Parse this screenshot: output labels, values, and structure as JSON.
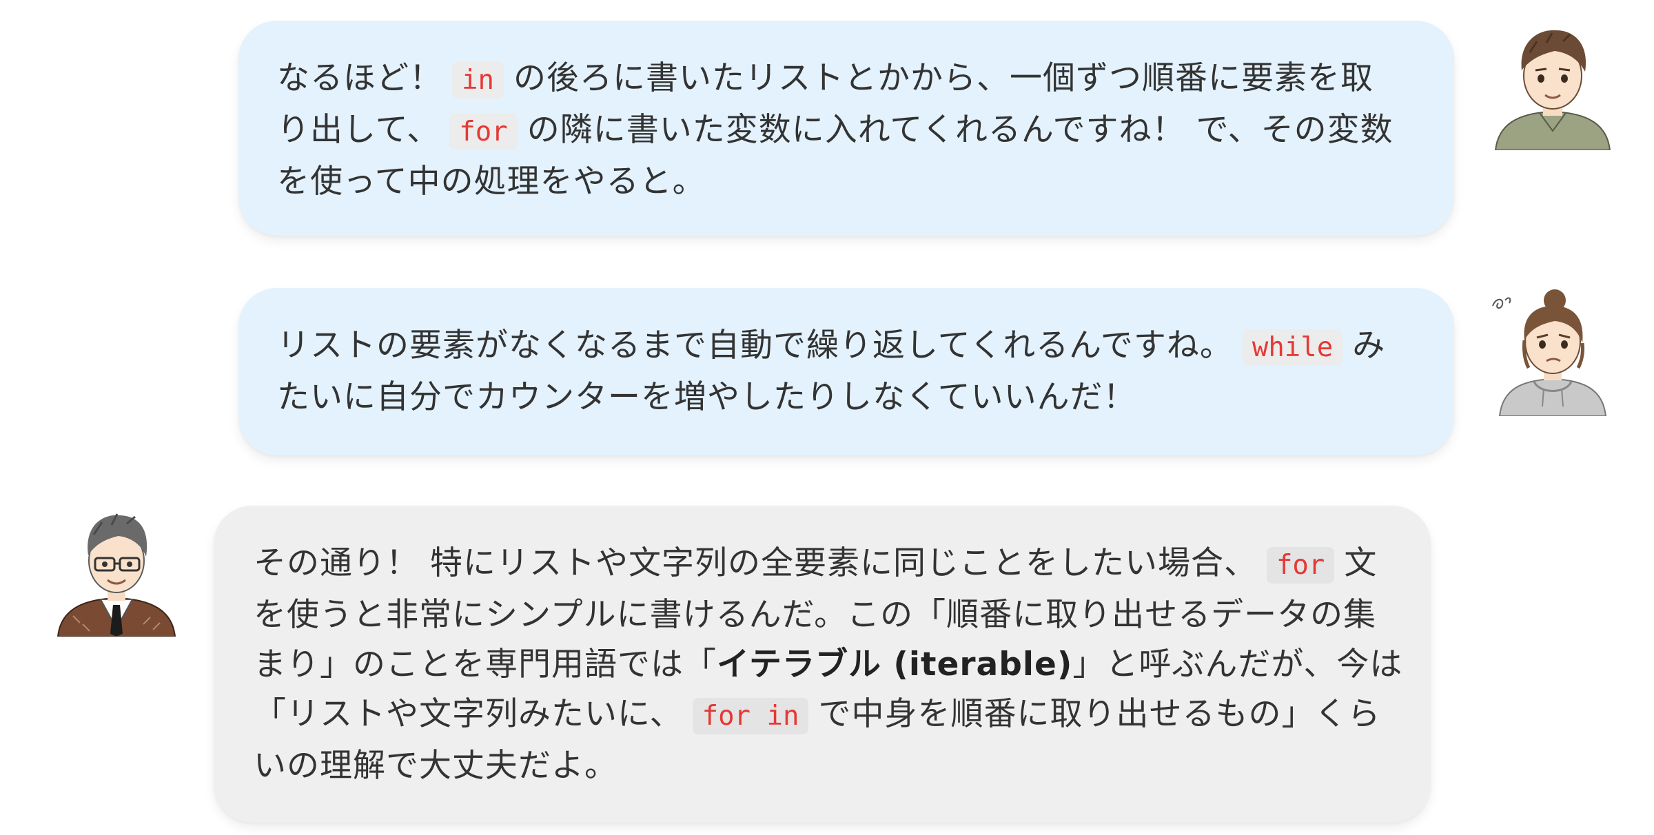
{
  "messages": [
    {
      "speaker": "student-boy",
      "lines": [
        [
          "なるほど！",
          "in",
          "の後ろに書いたリストとかから、一個ずつ順番に要素を取"
        ],
        [
          "り出して、",
          "for",
          "の隣に書いた変数に入れてくれるんですね！ で、その変数"
        ],
        [
          "を使って中の処理をやると。"
        ]
      ]
    },
    {
      "speaker": "student-girl",
      "lines": [
        [
          "リストの要素がなくなるまで自動で繰り返してくれるんですね。",
          "while",
          "み"
        ],
        [
          "たいに自分でカウンターを増やしたりしなくていいんだ！"
        ]
      ]
    },
    {
      "speaker": "teacher",
      "lines": [
        [
          "その通り！ 特にリストや文字列の全要素に同じことをしたい場合、",
          "for",
          "文"
        ],
        [
          "を使うと非常にシンプルに書けるんだ。この「順番に取り出せるデータの集"
        ],
        [
          "まり」のことを専門用語では「",
          "イテラブル (iterable)",
          "」と呼ぶんだが、今は"
        ],
        [
          "「リストや文字列みたいに、",
          "for in",
          "で中身を順番に取り出せるもの」くら"
        ],
        [
          "いの理解で大丈夫だよ。"
        ]
      ]
    }
  ],
  "icons": {
    "boy": "boy-avatar-icon",
    "girl": "girl-avatar-icon",
    "teacher": "teacher-avatar-icon"
  },
  "colors": {
    "student_bubble": "#e3f2fd",
    "teacher_bubble": "#efefef",
    "inline_code_text": "#e53935",
    "inline_code_bg": "#ececec",
    "body_text": "#333333"
  }
}
